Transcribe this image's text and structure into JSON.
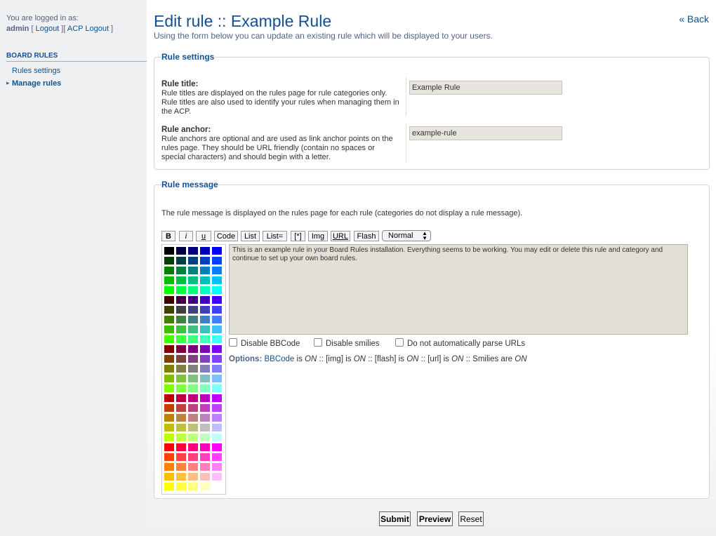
{
  "sidebar": {
    "logged_in_text": "You are logged in as:",
    "username": "admin",
    "logout": "Logout",
    "acp_logout": "ACP Logout",
    "section_title": "BOARD RULES",
    "items": [
      {
        "label": "Rules settings",
        "active": false
      },
      {
        "label": "Manage rules",
        "active": true
      }
    ]
  },
  "header": {
    "title": "Edit rule :: Example Rule",
    "description": "Using the form below you can update an existing rule which will be displayed to your users.",
    "back_label": "« Back"
  },
  "rule_settings": {
    "legend": "Rule settings",
    "title_label": "Rule title:",
    "title_help": "Rule titles are displayed on the rules page for rule categories only. Rule titles are also used to identify your rules when managing them in the ACP.",
    "title_value": "Example Rule",
    "anchor_label": "Rule anchor:",
    "anchor_help": "Rule anchors are optional and are used as link anchor points on the rules page. They should be URL friendly (contain no spaces or special characters) and should begin with a letter.",
    "anchor_value": "example-rule"
  },
  "rule_message": {
    "legend": "Rule message",
    "description": "The rule message is displayed on the rules page for each rule (categories do not display a rule message).",
    "toolbar": [
      "B",
      "i",
      "u",
      "Code",
      "List",
      "List=",
      "[*]",
      "Img",
      "URL",
      "Flash"
    ],
    "font_size": "Normal",
    "message": "This is an example rule in your Board Rules installation. Everything seems to be working. You may edit or delete this rule and category and continue to set up your own board rules.",
    "checkboxes": [
      "Disable BBCode",
      "Disable smilies",
      "Do not automatically parse URLs"
    ],
    "options": {
      "label": "Options:",
      "bbcode": "BBCode",
      "is": "is",
      "on": "ON",
      "img": "[img]",
      "flash": "[flash]",
      "url": "[url]",
      "smilies": "Smilies are",
      "sep": "::"
    }
  },
  "buttons": {
    "submit": "Submit",
    "preview": "Preview",
    "reset": "Reset"
  },
  "colors": {
    "heading": "#115098",
    "link": "#105289",
    "text": "#536482"
  }
}
